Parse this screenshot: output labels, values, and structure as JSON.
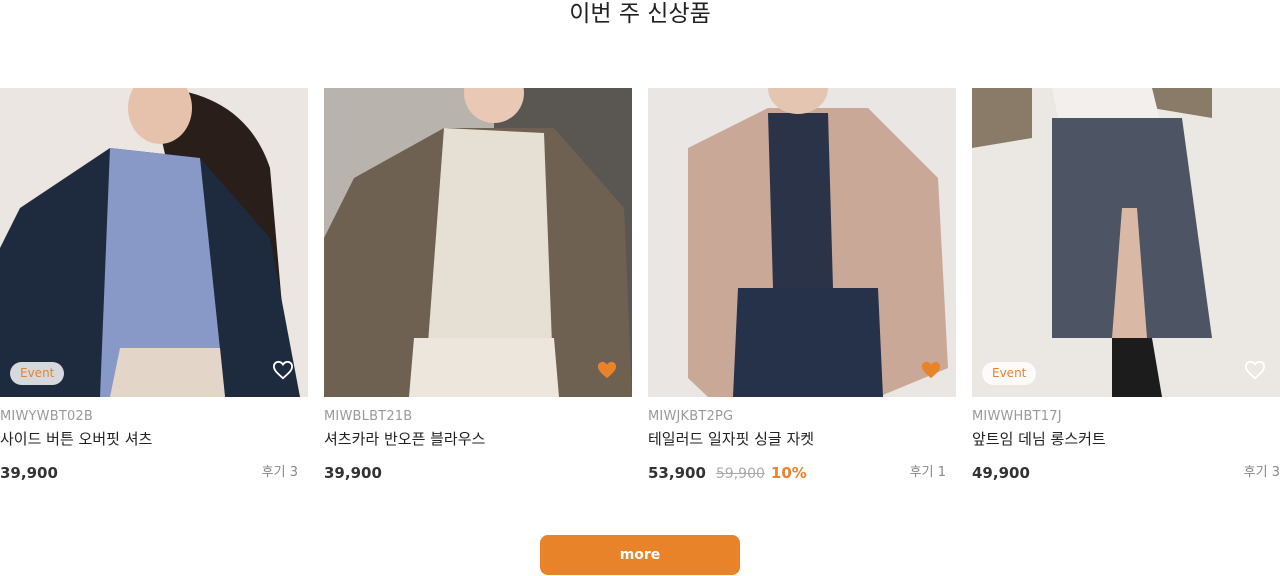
{
  "section": {
    "title": "이번 주 신상품"
  },
  "colors": {
    "accent": "#e8832a",
    "heart_filled": "#e8832a"
  },
  "products": [
    {
      "code": "MIWYWBT02B",
      "name": "사이드 버튼 오버핏 셔츠",
      "price": "39,900",
      "reviews": "후기 3",
      "badge": "Event",
      "wishlisted": false,
      "wish_icon": "heart-outline-icon"
    },
    {
      "code": "MIWBLBT21B",
      "name": "셔츠카라 반오픈 블라우스",
      "price": "39,900",
      "wishlisted": true,
      "wish_icon": "heart-filled-icon"
    },
    {
      "code": "MIWJKBT2PG",
      "name": "테일러드 일자핏 싱글 자켓",
      "price": "53,900",
      "original_price": "59,900",
      "discount": "10%",
      "reviews": "후기 1",
      "wishlisted": true,
      "wish_icon": "heart-filled-icon"
    },
    {
      "code": "MIWWHBT17J",
      "name": "앞트임 데님 롱스커트",
      "price": "49,900",
      "reviews": "후기 3",
      "badge": "Event",
      "wishlisted": false,
      "wish_icon": "heart-outline-icon"
    }
  ],
  "more": {
    "label": "more"
  }
}
